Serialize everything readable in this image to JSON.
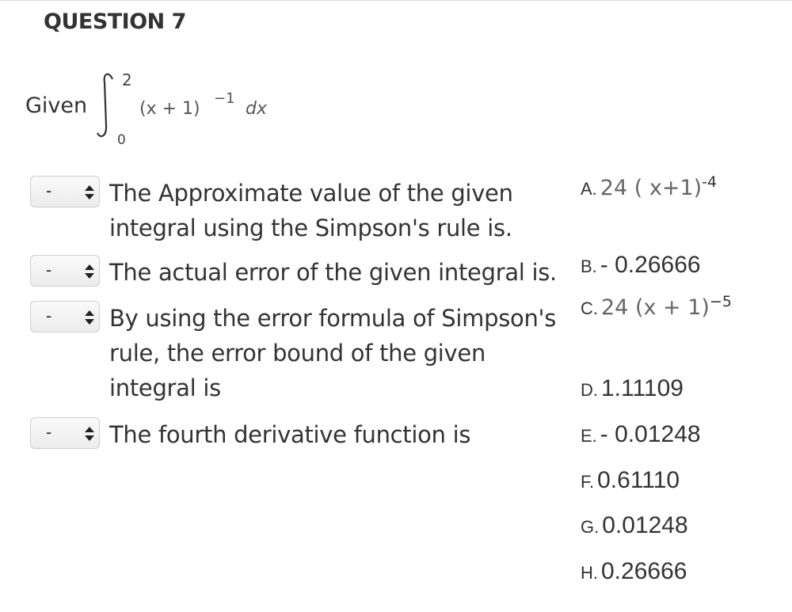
{
  "question": {
    "title": "QUESTION 7",
    "given_label": "Given",
    "integral": {
      "upper_limit": "2",
      "lower_limit": "0",
      "integrand": "(x + 1)",
      "exponent": "−1",
      "differential": "dx"
    }
  },
  "items": [
    {
      "selected": "-",
      "text": "The Approximate value of the given integral using the Simpson's rule is."
    },
    {
      "selected": "-",
      "text": "The actual error of the given integral is."
    },
    {
      "selected": "-",
      "text": "By using the error formula of Simpson's rule, the error bound of the given integral is"
    },
    {
      "selected": "-",
      "text": "The fourth derivative function is"
    }
  ],
  "options": [
    {
      "label": "A.",
      "base": "24 ( x+1)",
      "exp": "-4"
    },
    {
      "label": "B.",
      "value": "- 0.26666"
    },
    {
      "label": "C.",
      "base": "24 (x + 1)",
      "exp": "−5"
    },
    {
      "label": "D.",
      "value": "1.11109"
    },
    {
      "label": "E.",
      "value": "- 0.01248"
    },
    {
      "label": "F.",
      "value": "0.61110"
    },
    {
      "label": "G.",
      "value": "0.01248"
    },
    {
      "label": "H.",
      "value": "0.26666"
    }
  ]
}
